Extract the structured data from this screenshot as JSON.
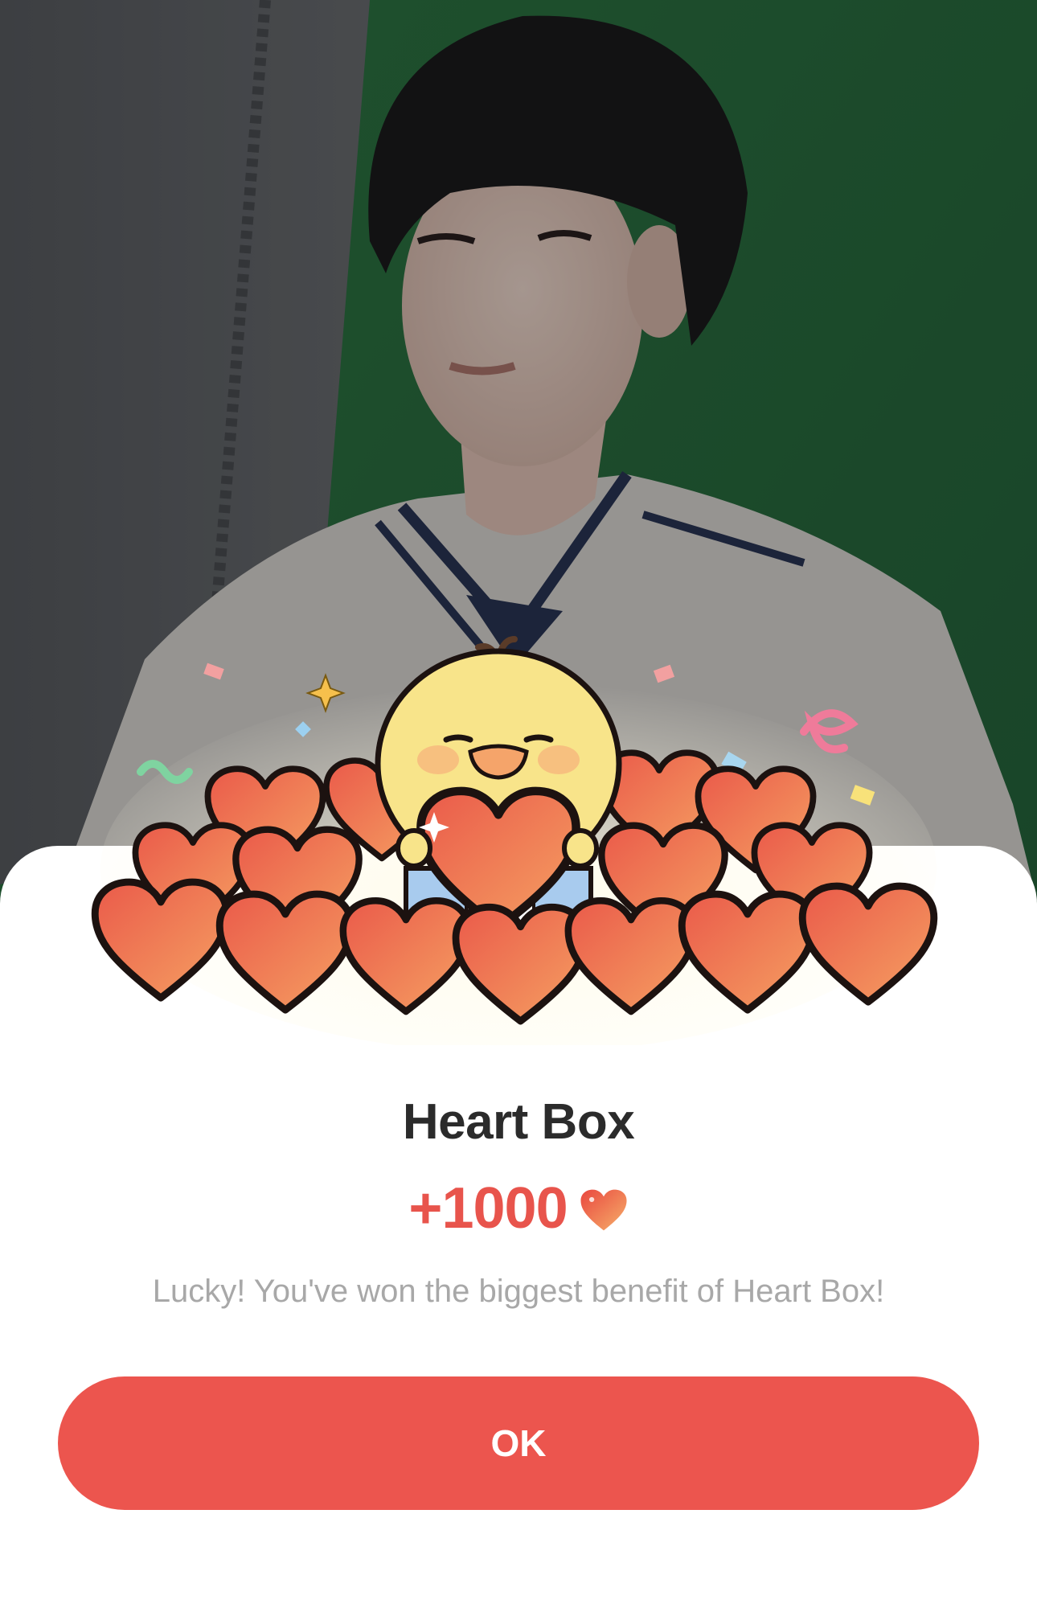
{
  "dialog": {
    "title": "Heart Box",
    "reward_amount": "+1000",
    "reward_icon": "heart-icon",
    "message": "Lucky! You've won the biggest benefit of Heart Box!",
    "ok_label": "OK"
  },
  "colors": {
    "accent": "#ec554e",
    "reward_text": "#e8544c",
    "title_text": "#2b2b2b",
    "message_text": "#a8a8a8",
    "sheet_background": "#ffffff"
  }
}
